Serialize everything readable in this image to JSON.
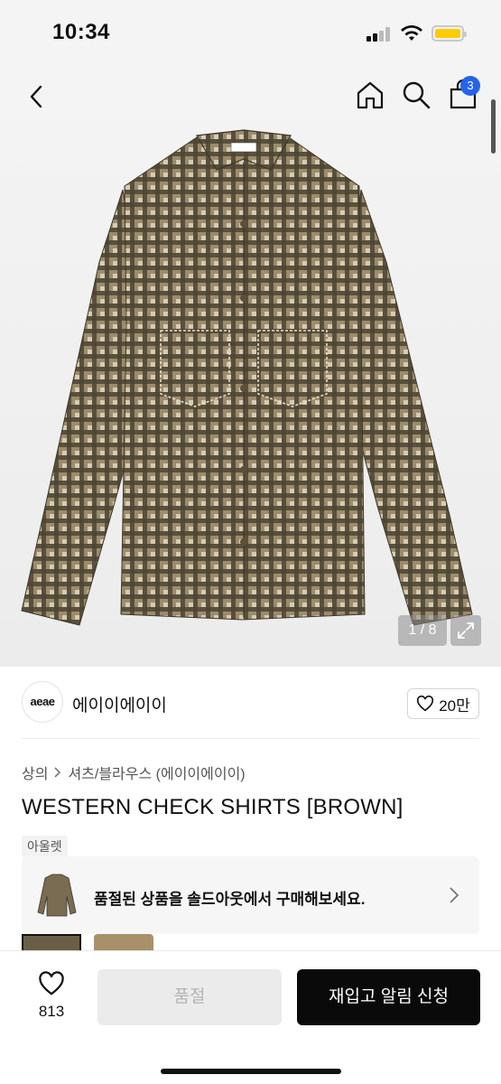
{
  "status": {
    "time": "10:34"
  },
  "header": {
    "cart_count": "3"
  },
  "gallery": {
    "pager": "1 / 8"
  },
  "brand": {
    "logo_text": "aeae",
    "name": "에이이에이이",
    "likes": "20만"
  },
  "breadcrumb": {
    "category": "상의",
    "subcategory": "셔츠/블라우스 (에이이에이이)"
  },
  "product": {
    "title": "WESTERN CHECK SHIRTS [BROWN]",
    "tag": "아울렛"
  },
  "banner": {
    "text": "품절된 상품을 솔드아웃에서 구매해보세요."
  },
  "bottom": {
    "wish_count": "813",
    "soldout_label": "품절",
    "restock_label": "재입고 알림 신청"
  },
  "colors": {
    "accent_blue": "#2563eb",
    "shirt": "#6b6049",
    "cta": "#0a0a0a"
  },
  "icons": [
    "back-icon",
    "home-icon",
    "search-icon",
    "cart-icon",
    "expand-icon",
    "heart-icon",
    "chevron-right-icon"
  ]
}
